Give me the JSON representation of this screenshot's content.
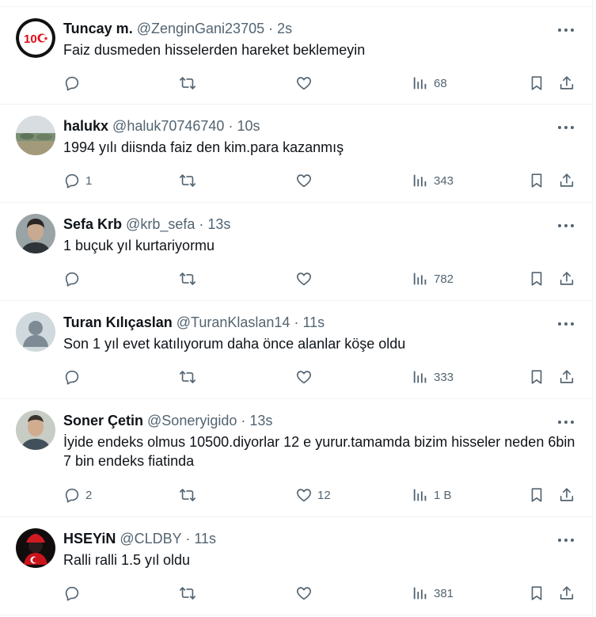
{
  "tweets": [
    {
      "name": "Tuncay m.",
      "handle": "@ZenginGani23705",
      "dot": "·",
      "time": "2s",
      "text": "Faiz dusmeden hisselerden hareket beklemeyin",
      "replies": "",
      "likes": "",
      "views": "68",
      "avatar": "logo-100-avatar"
    },
    {
      "name": "halukx",
      "handle": "@haluk70746740",
      "dot": "·",
      "time": "10s",
      "text": "1994 yılı diisnda faiz den kim.para kazanmış",
      "replies": "1",
      "likes": "",
      "views": "343",
      "avatar": "landscape-avatar"
    },
    {
      "name": "Sefa Krb",
      "handle": "@krb_sefa",
      "dot": "·",
      "time": "13s",
      "text": "1 buçuk yıl kurtariyormu",
      "replies": "",
      "likes": "",
      "views": "782",
      "avatar": "photo-avatar"
    },
    {
      "name": "Turan Kılıçaslan",
      "handle": "@TuranKlaslan14",
      "dot": "·",
      "time": "11s",
      "text": "Son 1 yıl evet katılıyorum daha önce alanlar köşe oldu",
      "replies": "",
      "likes": "",
      "views": "333",
      "avatar": "default-avatar"
    },
    {
      "name": "Soner Çetin",
      "handle": "@Soneryigido",
      "dot": "·",
      "time": "13s",
      "text": "İyide endeks olmus 10500.diyorlar 12 e yurur.tamamda bizim hisseler neden 6bin 7 bin endeks fiatinda",
      "replies": "2",
      "likes": "12",
      "views": "1 B",
      "avatar": "photo-avatar"
    },
    {
      "name": "HSEYiN",
      "handle": "@CLDBY",
      "dot": "·",
      "time": "11s",
      "text": "Ralli ralli 1.5 yıl oldu",
      "replies": "",
      "likes": "",
      "views": "381",
      "avatar": "flag-avatar"
    }
  ],
  "colors": {
    "text": "#0f1419",
    "secondary": "#536471",
    "border": "#eff3f4",
    "logo_red": "#e30a17"
  }
}
